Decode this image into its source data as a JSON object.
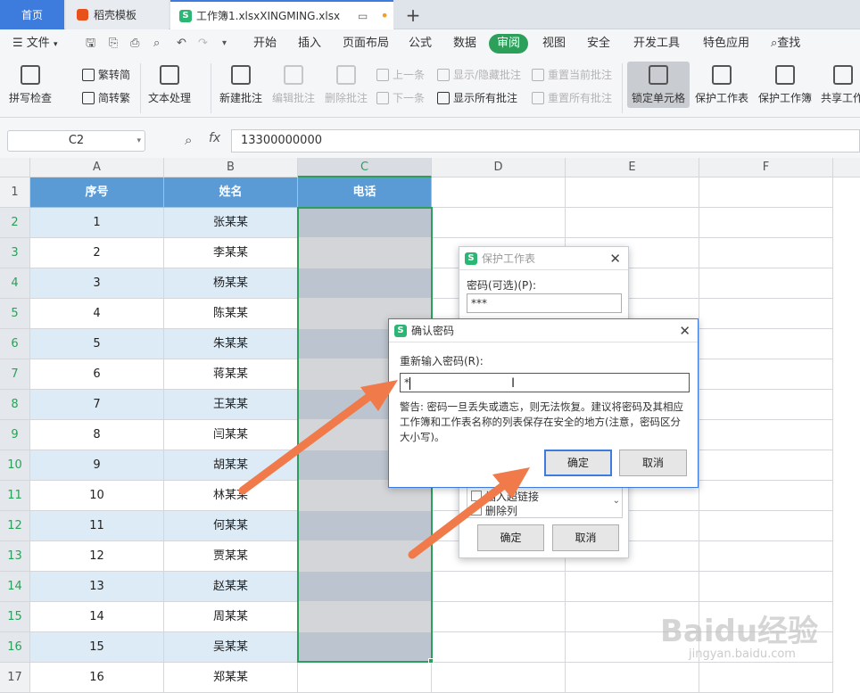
{
  "tabs": {
    "home": "首页",
    "daoke": "稻壳模板",
    "doc": "工作簿1.xlsxXINGMING.xlsx",
    "add": "+"
  },
  "menu": {
    "file": "文件",
    "items": [
      "开始",
      "插入",
      "页面布局",
      "公式",
      "数据",
      "审阅",
      "视图",
      "安全",
      "开发工具",
      "特色应用"
    ],
    "search": "查找"
  },
  "ribbon": {
    "spell": "拼写检查",
    "trad": "繁转简",
    "simp": "简转繁",
    "text_proc": "文本处理",
    "new_comment": "新建批注",
    "edit_comment": "编辑批注",
    "delete_comment": "删除批注",
    "prev": "上一条",
    "next": "下一条",
    "show_hide": "显示/隐藏批注",
    "show_all": "显示所有批注",
    "reset_current": "重置当前批注",
    "reset_all": "重置所有批注",
    "lock_cell": "锁定单元格",
    "protect_sheet": "保护工作表",
    "protect_book": "保护工作簿",
    "share": "共享工作"
  },
  "formula": {
    "cell_ref": "C2",
    "fx": "fx",
    "value": "13300000000"
  },
  "columns": [
    "A",
    "B",
    "C",
    "D",
    "E",
    "F"
  ],
  "table": {
    "headers": [
      "序号",
      "姓名",
      "电话"
    ],
    "rows": [
      [
        "1",
        "张某某"
      ],
      [
        "2",
        "李某某"
      ],
      [
        "3",
        "杨某某"
      ],
      [
        "4",
        "陈某某"
      ],
      [
        "5",
        "朱某某"
      ],
      [
        "6",
        "蒋某某"
      ],
      [
        "7",
        "王某某"
      ],
      [
        "8",
        "闫某某"
      ],
      [
        "9",
        "胡某某"
      ],
      [
        "10",
        "林某某"
      ],
      [
        "11",
        "何某某"
      ],
      [
        "12",
        "贾某某"
      ],
      [
        "13",
        "赵某某"
      ],
      [
        "14",
        "周某某"
      ],
      [
        "15",
        "吴某某"
      ],
      [
        "16",
        "郑某某"
      ]
    ],
    "row_numbers": [
      "1",
      "2",
      "3",
      "4",
      "5",
      "6",
      "7",
      "8",
      "9",
      "10",
      "11",
      "12",
      "13",
      "14",
      "15",
      "16",
      "17"
    ]
  },
  "protect_dialog": {
    "title": "保护工作表",
    "password_label": "密码(可选)(P):",
    "password_value": "***",
    "list_item": "插入超链接",
    "list_item2": "删除列",
    "ok": "确定",
    "cancel": "取消"
  },
  "confirm_dialog": {
    "title": "确认密码",
    "reenter_label": "重新输入密码(R):",
    "input_value": "*",
    "warning": "警告: 密码一旦丢失或遗忘，则无法恢复。建议将密码及其相应工作簿和工作表名称的列表保存在安全的地方(注意，密码区分大小写)。",
    "ok": "确定",
    "cancel": "取消"
  },
  "watermark": {
    "brand": "Baidu经验",
    "url": "jingyan.baidu.com"
  },
  "colors": {
    "header_blue": "#5b9bd5",
    "band_blue": "#ddebf7",
    "green": "#2ca05a",
    "arrow": "#f07a4a"
  }
}
